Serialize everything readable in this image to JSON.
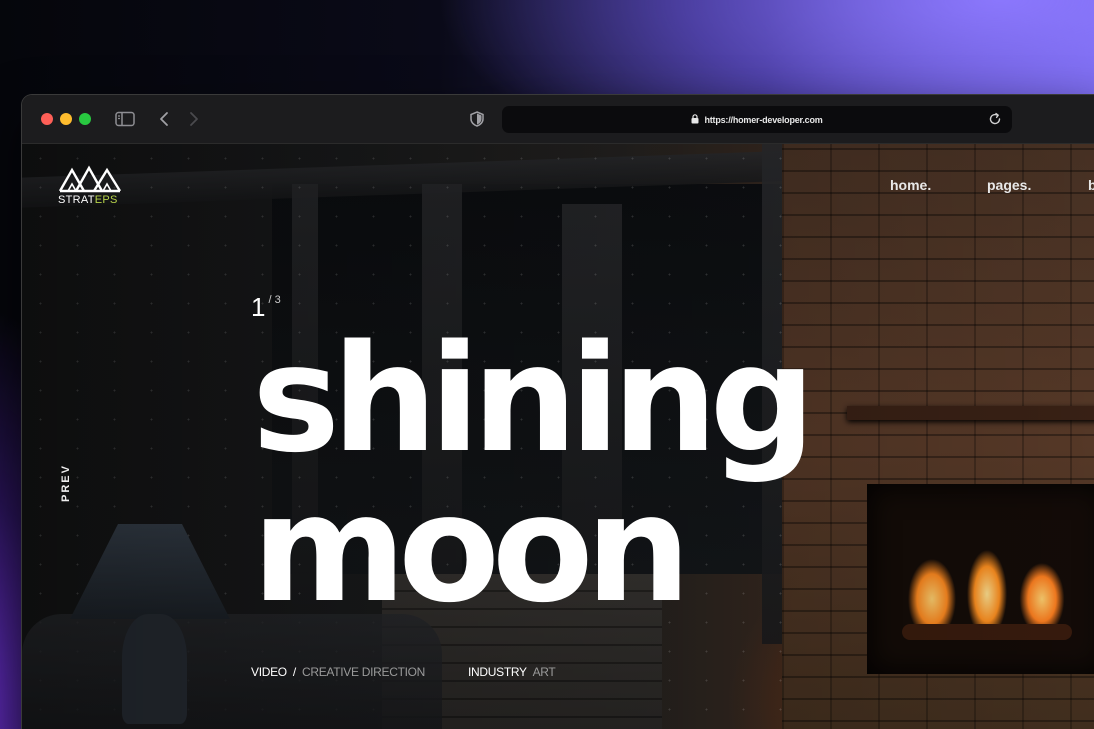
{
  "browser": {
    "url": "https://homer-developer.com"
  },
  "site": {
    "logo_text_main": "STRAT",
    "logo_text_accent": "EPS",
    "nav": {
      "home": "home.",
      "pages": "pages.",
      "third": "b"
    }
  },
  "hero": {
    "slide_current": "1",
    "slide_total": "/ 3",
    "title_line1": "shining",
    "title_line2": "moon",
    "prev_label": "PREV",
    "meta": {
      "type_label": "VIDEO",
      "separator": "/",
      "type_value": "CREATIVE DIRECTION",
      "industry_label": "INDUSTRY",
      "industry_value": "ART"
    }
  },
  "colors": {
    "logo_accent": "#b7d44a",
    "traffic_red": "#fe5f57",
    "traffic_yellow": "#febc2e",
    "traffic_green": "#28c840"
  },
  "icons": [
    "sidebar-icon",
    "back-icon",
    "forward-icon",
    "shield-icon",
    "lock-icon",
    "reload-icon"
  ]
}
